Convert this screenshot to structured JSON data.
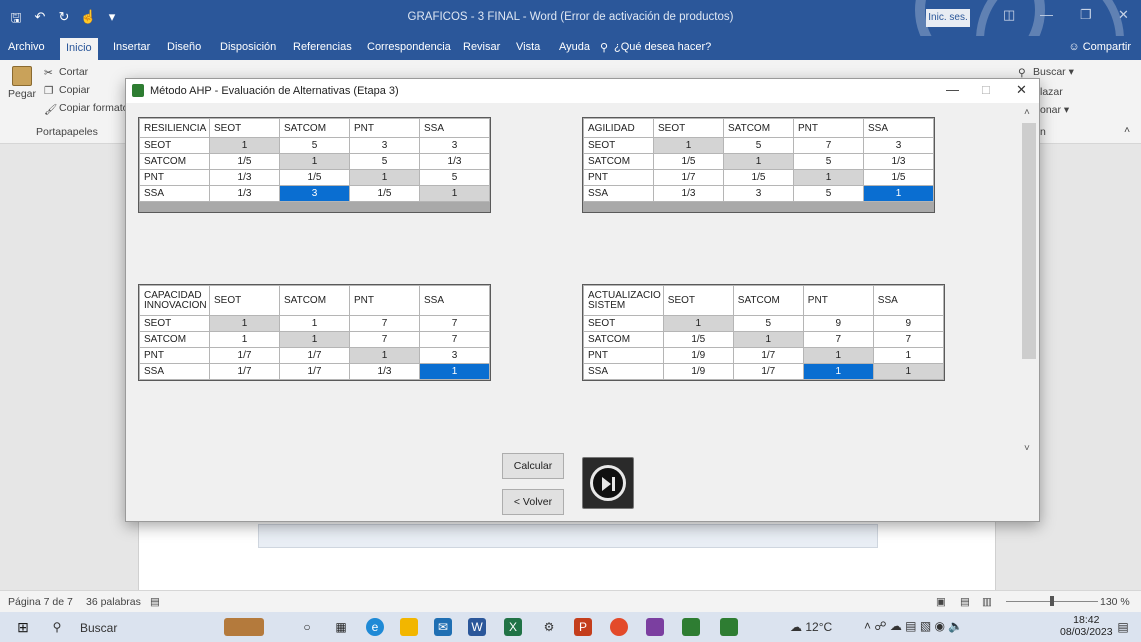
{
  "word": {
    "doc_title": "GRAFICOS - 3 FINAL  -  Word (Error de activación de productos)",
    "signin": "Inic. ses.",
    "tabs": [
      "Archivo",
      "Inicio",
      "Insertar",
      "Diseño",
      "Disposición",
      "Referencias",
      "Correspondencia",
      "Revisar",
      "Vista",
      "Ayuda",
      "¿Qué desea hacer?"
    ],
    "share": "Compartir",
    "clipboard": {
      "cut": "Cortar",
      "copy": "Copiar",
      "paste": "Pegar",
      "format": "Copiar formato",
      "group": "Portapapeles"
    },
    "editing": {
      "find": "Buscar",
      "replace": "lazar",
      "select": "onar",
      "group": "n"
    },
    "status": {
      "page": "Página 7 de 7",
      "words": "36 palabras",
      "zoom": "130 %"
    }
  },
  "taskbar": {
    "search": "Buscar",
    "temp": "12°C",
    "time": "18:42",
    "date": "08/03/2023"
  },
  "dialog": {
    "title": "Método AHP - Evaluación de Alternativas (Etapa 3)",
    "calc_button": "Calcular",
    "back_button": "< Volver",
    "matrices": [
      {
        "criterion": "RESILIENCIA",
        "columns": [
          "SEOT",
          "SATCOM",
          "PNT",
          "SSA"
        ],
        "rows": [
          {
            "label": "SEOT",
            "values": [
              "1",
              "5",
              "3",
              "3"
            ]
          },
          {
            "label": "SATCOM",
            "values": [
              "1/5",
              "1",
              "5",
              "1/3"
            ]
          },
          {
            "label": "PNT",
            "values": [
              "1/3",
              "1/5",
              "1",
              "5"
            ]
          },
          {
            "label": "SSA",
            "values": [
              "1/3",
              "3",
              "1/5",
              "1"
            ]
          }
        ]
      },
      {
        "criterion": "AGILIDAD",
        "columns": [
          "SEOT",
          "SATCOM",
          "PNT",
          "SSA"
        ],
        "rows": [
          {
            "label": "SEOT",
            "values": [
              "1",
              "5",
              "7",
              "3"
            ]
          },
          {
            "label": "SATCOM",
            "values": [
              "1/5",
              "1",
              "5",
              "1/3"
            ]
          },
          {
            "label": "PNT",
            "values": [
              "1/7",
              "1/5",
              "1",
              "1/5"
            ]
          },
          {
            "label": "SSA",
            "values": [
              "1/3",
              "3",
              "5",
              "1"
            ]
          }
        ]
      },
      {
        "criterion_l1": "CAPACIDAD",
        "criterion_l2": "INNOVACION",
        "columns": [
          "SEOT",
          "SATCOM",
          "PNT",
          "SSA"
        ],
        "rows": [
          {
            "label": "SEOT",
            "values": [
              "1",
              "1",
              "7",
              "7"
            ]
          },
          {
            "label": "SATCOM",
            "values": [
              "1",
              "1",
              "7",
              "7"
            ]
          },
          {
            "label": "PNT",
            "values": [
              "1/7",
              "1/7",
              "1",
              "3"
            ]
          },
          {
            "label": "SSA",
            "values": [
              "1/7",
              "1/7",
              "1/3",
              "1"
            ]
          }
        ]
      },
      {
        "criterion_l1": "ACTUALIZACIO",
        "criterion_l2": "SISTEM",
        "columns": [
          "SEOT",
          "SATCOM",
          "PNT",
          "SSA"
        ],
        "rows": [
          {
            "label": "SEOT",
            "values": [
              "1",
              "5",
              "9",
              "9"
            ]
          },
          {
            "label": "SATCOM",
            "values": [
              "1/5",
              "1",
              "7",
              "7"
            ]
          },
          {
            "label": "PNT",
            "values": [
              "1/9",
              "1/7",
              "1",
              "1"
            ]
          },
          {
            "label": "SSA",
            "values": [
              "1/9",
              "1/7",
              "1",
              "1"
            ]
          }
        ]
      }
    ]
  }
}
